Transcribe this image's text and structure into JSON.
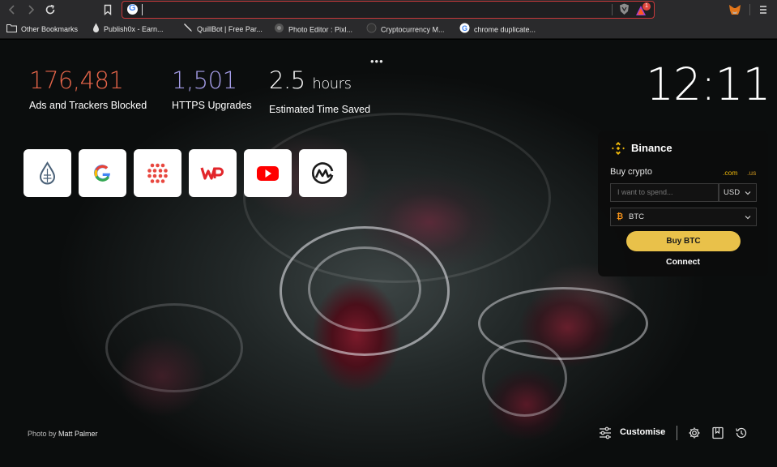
{
  "browser": {
    "address_value": "",
    "rewards_badge": "1",
    "bookmarks": [
      {
        "label": "Other Bookmarks",
        "icon": "folder-icon"
      },
      {
        "label": "Publish0x - Earn...",
        "icon": "droplet-icon"
      },
      {
        "label": "QuillBot | Free Par...",
        "icon": "quill-icon"
      },
      {
        "label": "Photo Editor : Pixl...",
        "icon": "photo-editor-icon"
      },
      {
        "label": "Cryptocurrency M...",
        "icon": "crypto-icon"
      },
      {
        "label": "chrome duplicate...",
        "icon": "google-icon"
      }
    ]
  },
  "stats": {
    "ads_blocked": {
      "value": "176,481",
      "label": "Ads and Trackers Blocked",
      "color": "#e8664a"
    },
    "https_upgrades": {
      "value": "1,501",
      "label": "HTTPS Upgrades",
      "color": "#a59de8"
    },
    "time_saved": {
      "value": "2.5",
      "unit": "hours",
      "label": "Estimated Time Saved",
      "color": "#ffffff"
    }
  },
  "more_menu": "•••",
  "clock": "12:11",
  "top_sites": [
    {
      "name": "publish0x",
      "icon": "droplet-icon"
    },
    {
      "name": "google",
      "icon": "google-icon"
    },
    {
      "name": "dots-site",
      "icon": "dots-grid-icon"
    },
    {
      "name": "wp",
      "icon": "wp-icon"
    },
    {
      "name": "youtube",
      "icon": "youtube-icon"
    },
    {
      "name": "coinmarketcap",
      "icon": "coinmarketcap-icon"
    }
  ],
  "binance": {
    "title": "Binance",
    "buy_label": "Buy crypto",
    "domain_com": ".com",
    "domain_us": ".us",
    "amount_placeholder": "I want to spend...",
    "currency": "USD",
    "asset": "BTC",
    "buy_button": "Buy BTC",
    "connect": "Connect",
    "accent": "#f0b90b"
  },
  "footer": {
    "photo_by": "Photo by",
    "photographer": "Matt Palmer",
    "customise": "Customise"
  }
}
